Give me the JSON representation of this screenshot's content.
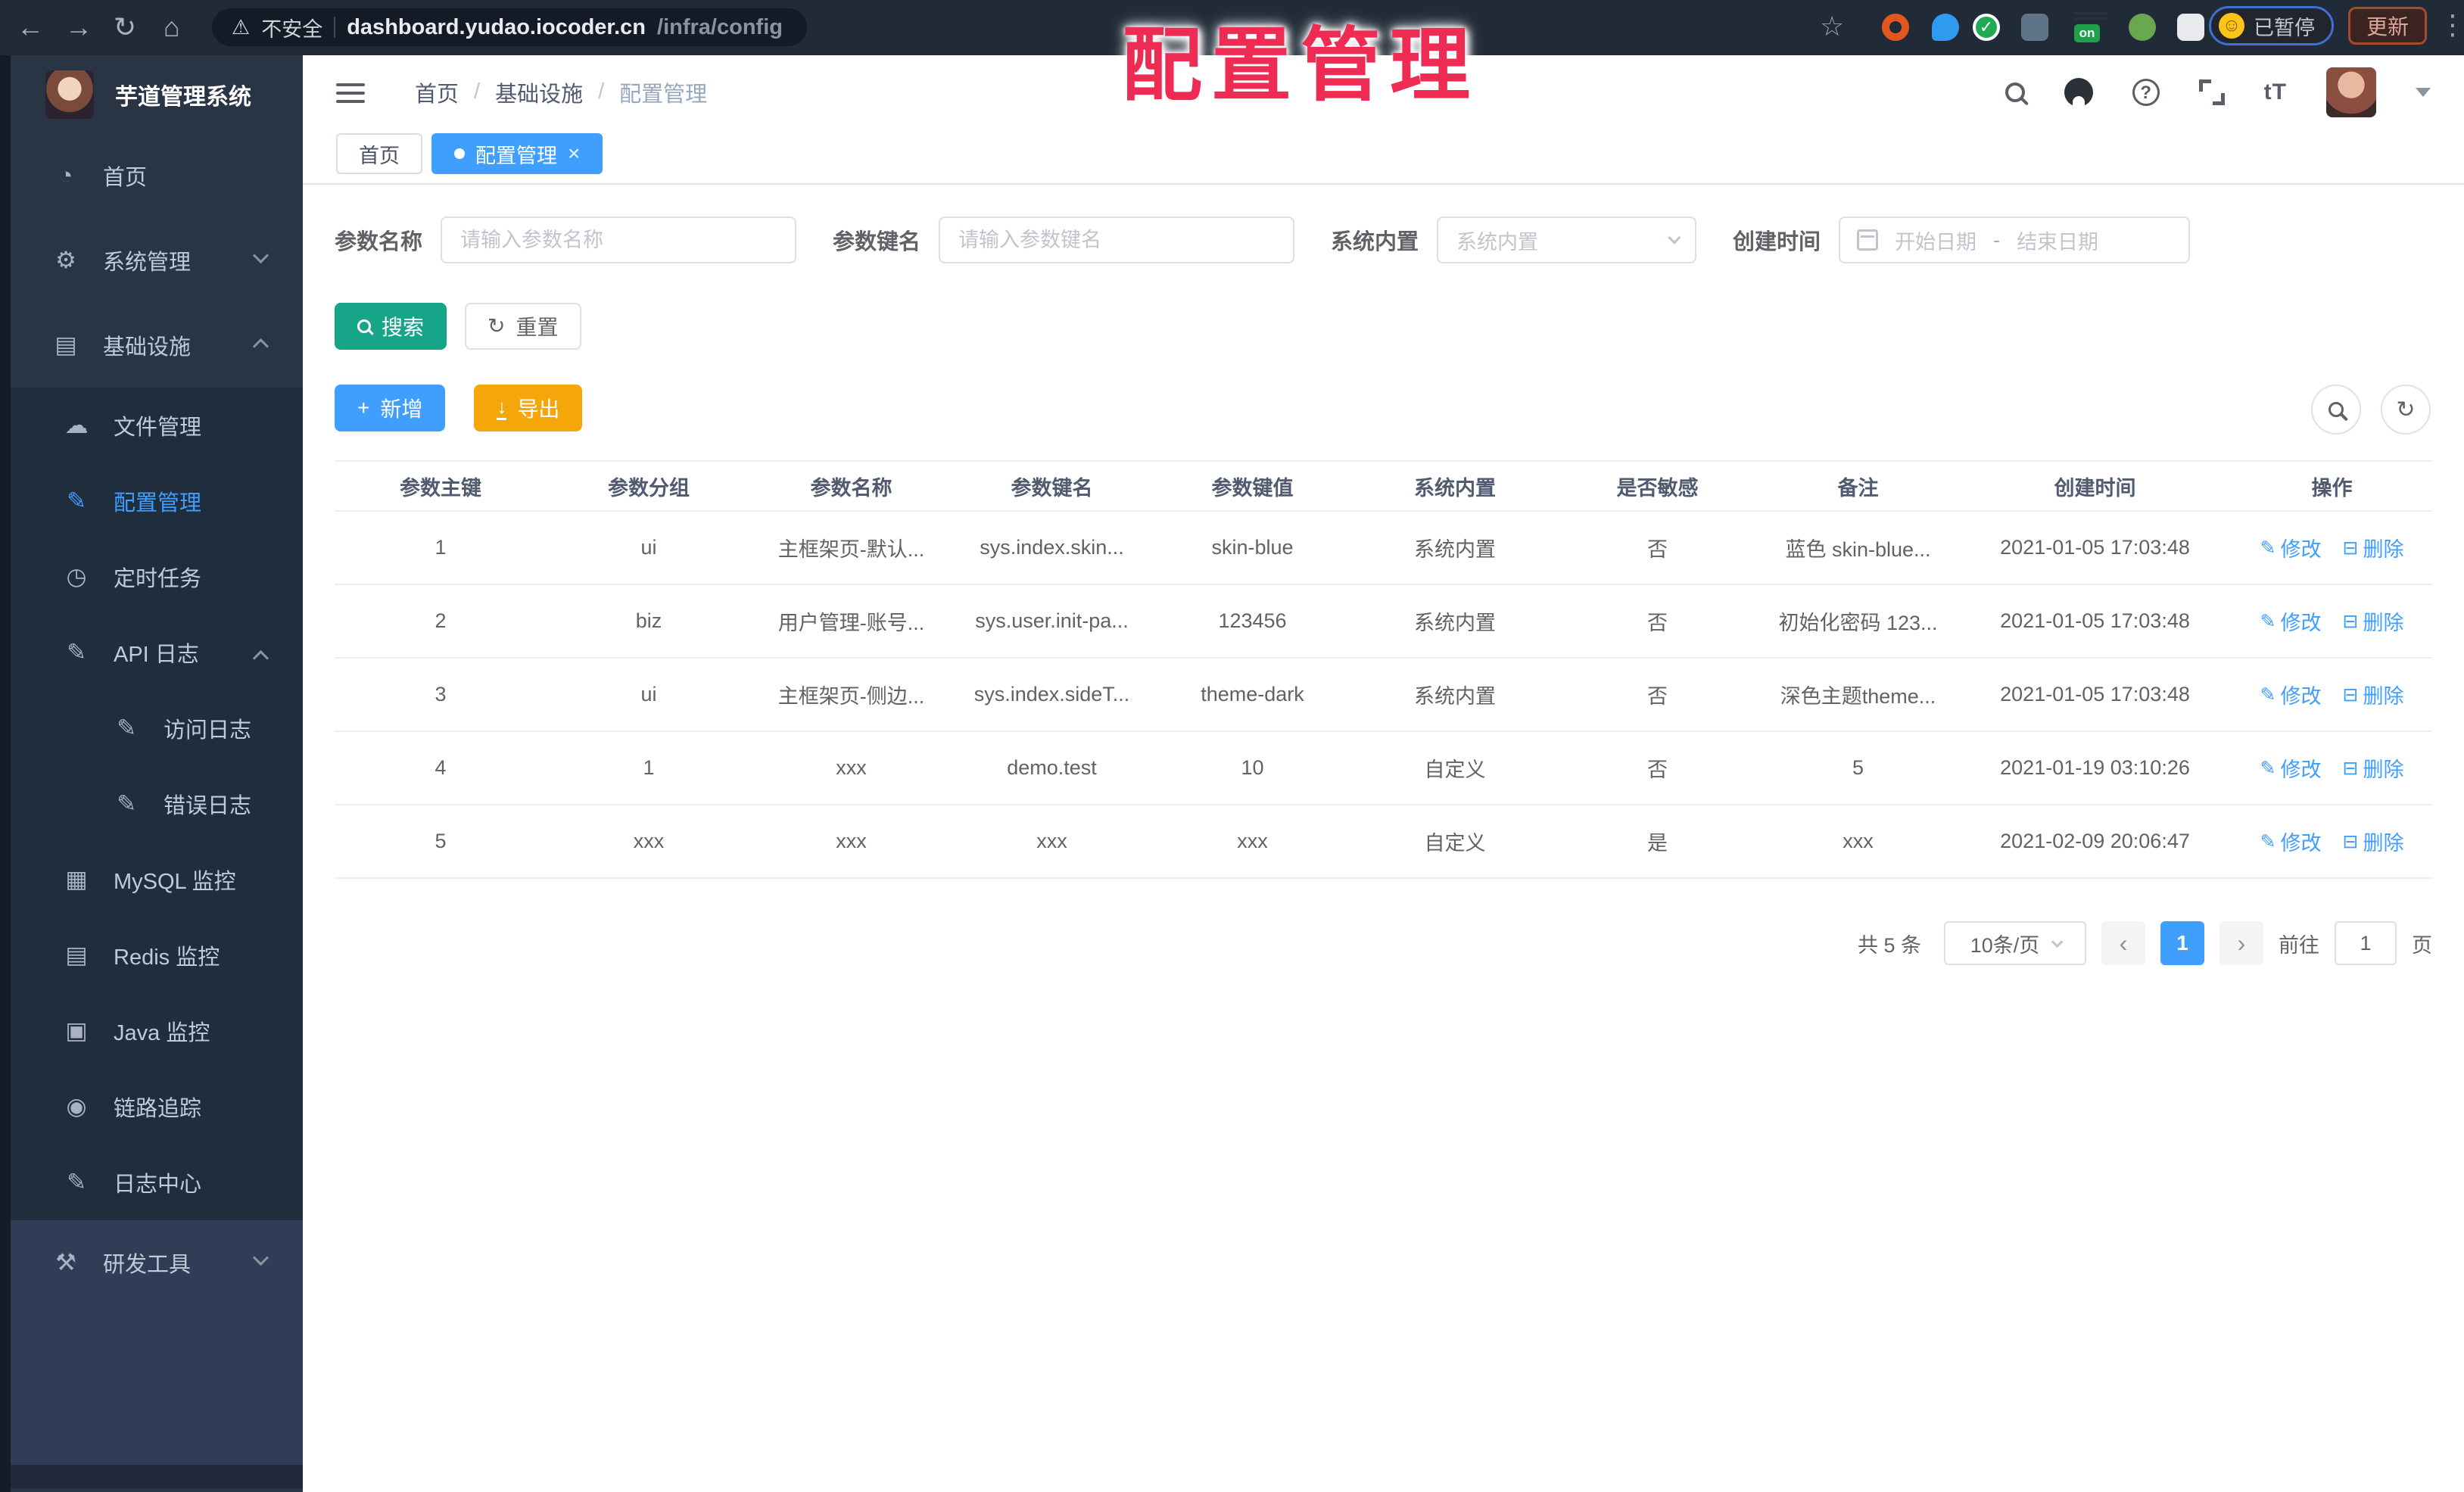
{
  "colors": {
    "accent_blue": "#409eff",
    "search_teal": "#16a589",
    "export_orange": "#f5a60b",
    "overlay_red": "#ee2b52",
    "sidebar_bg": "#293444",
    "submenu_bg": "#1f2d3d",
    "browser_bar_bg": "#212b38"
  },
  "overlay_title": "配置管理",
  "browser": {
    "security_label": "不安全",
    "url_host": "dashboard.yudao.iocoder.cn",
    "url_path": "/infra/config",
    "on_badge": "on",
    "paused_label": "已暂停",
    "update_label": "更新"
  },
  "sidebar": {
    "app_title": "芋道管理系统",
    "items": {
      "home": "首页",
      "system": "系统管理",
      "infra": "基础设施",
      "files": "文件管理",
      "config": "配置管理",
      "jobs": "定时任务",
      "api_log": "API 日志",
      "access_log": "访问日志",
      "error_log": "错误日志",
      "mysql": "MySQL 监控",
      "redis": "Redis 监控",
      "java": "Java 监控",
      "trace": "链路追踪",
      "log_center": "日志中心",
      "dev_tools": "研发工具"
    }
  },
  "breadcrumb": {
    "home": "首页",
    "section": "基础设施",
    "page": "配置管理",
    "separator": "/"
  },
  "tabs": {
    "home": "首页",
    "active": "配置管理",
    "close": "×"
  },
  "filters": {
    "name_label": "参数名称",
    "name_placeholder": "请输入参数名称",
    "key_label": "参数键名",
    "key_placeholder": "请输入参数键名",
    "builtin_label": "系统内置",
    "builtin_placeholder": "系统内置",
    "time_label": "创建时间",
    "start_placeholder": "开始日期",
    "range_separator": "-",
    "end_placeholder": "结束日期"
  },
  "buttons": {
    "search": "搜索",
    "reset": "重置",
    "add": "新增",
    "export": "导出"
  },
  "table": {
    "columns": [
      "参数主键",
      "参数分组",
      "参数名称",
      "参数键名",
      "参数键值",
      "系统内置",
      "是否敏感",
      "备注",
      "创建时间",
      "操作"
    ],
    "rows": [
      [
        "1",
        "ui",
        "主框架页-默认...",
        "sys.index.skin...",
        "skin-blue",
        "系统内置",
        "否",
        "蓝色 skin-blue...",
        "2021-01-05 17:03:48"
      ],
      [
        "2",
        "biz",
        "用户管理-账号...",
        "sys.user.init-pa...",
        "123456",
        "系统内置",
        "否",
        "初始化密码 123...",
        "2021-01-05 17:03:48"
      ],
      [
        "3",
        "ui",
        "主框架页-侧边...",
        "sys.index.sideT...",
        "theme-dark",
        "系统内置",
        "否",
        "深色主题theme...",
        "2021-01-05 17:03:48"
      ],
      [
        "4",
        "1",
        "xxx",
        "demo.test",
        "10",
        "自定义",
        "否",
        "5",
        "2021-01-19 03:10:26"
      ],
      [
        "5",
        "xxx",
        "xxx",
        "xxx",
        "xxx",
        "自定义",
        "是",
        "xxx",
        "2021-02-09 20:06:47"
      ]
    ]
  },
  "row_actions": {
    "edit": "修改",
    "delete": "删除"
  },
  "pagination": {
    "total": "共 5 条",
    "page_size": "10条/页",
    "page": "1",
    "goto_label": "前往",
    "goto_value": "1",
    "unit_label": "页",
    "prev": "‹",
    "next": "›"
  },
  "icons": {
    "back": "←",
    "forward": "→",
    "reload": "↻",
    "home": "⌂",
    "warning": "⚠",
    "bookmark_star": "☆",
    "overflow_dots": "⋮",
    "smiley": "☺",
    "dashboard": "◔",
    "gear": "⚙",
    "infra": "▤",
    "cloud": "☁",
    "edit": "✎",
    "timer": "◷",
    "log": "✎",
    "mysql": "▦",
    "redis": "▤",
    "java": "▣",
    "eye": "◉",
    "tools": "⚒",
    "plus": "+",
    "download": "↓",
    "refresh": "↻",
    "delete": "⊟",
    "font_size": "tT",
    "help": "?"
  }
}
